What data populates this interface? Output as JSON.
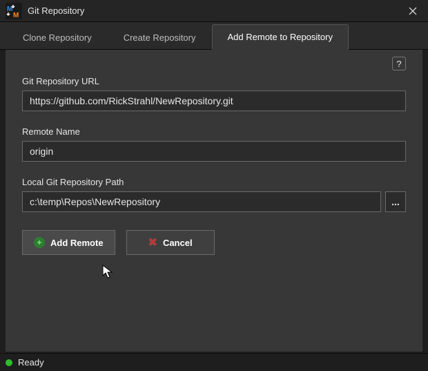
{
  "window": {
    "title": "Git Repository"
  },
  "tabs": {
    "clone": "Clone Repository",
    "create": "Create Repository",
    "addremote": "Add Remote to Repository"
  },
  "form": {
    "url_label": "Git Repository URL",
    "url_value": "https://github.com/RickStrahl/NewRepository.git",
    "remote_label": "Remote Name",
    "remote_value": "origin",
    "path_label": "Local Git Repository Path",
    "path_value": "c:\\temp\\Repos\\NewRepository",
    "browse_label": "...",
    "add_button": "Add Remote",
    "cancel_button": "Cancel"
  },
  "help": {
    "label": "?"
  },
  "status": {
    "text": "Ready"
  }
}
